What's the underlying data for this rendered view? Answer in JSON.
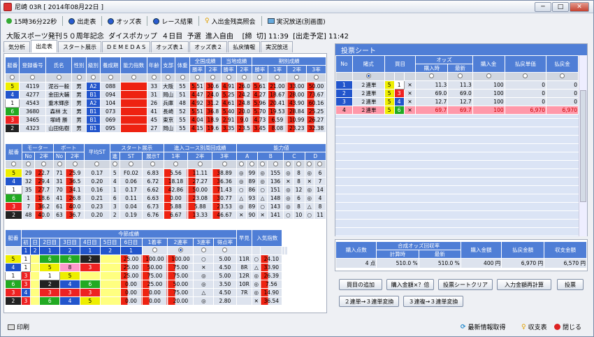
{
  "window": {
    "title": "尼崎 03R [ 2014年08月22日 ]",
    "min": "─",
    "max": "□",
    "close": "✕"
  },
  "toolbar": {
    "time": "15時36分22秒",
    "b1": "出走表",
    "b2": "オッズ表",
    "b3": "レース結果",
    "b4": "入出金残高照会",
    "b5": "実況放送(別画面)"
  },
  "race": "大阪スポーツ発刊５０周年記念  ダイスポカップ  ４日目  予選  進入自由    [締  切] 11:39  [出走予定] 11:42",
  "tabs": [
    "気分析",
    "出走表",
    "スタート展示",
    "D E M E D A S",
    "オッズ表１",
    "オッズ表２",
    "払戻情報",
    "実況放送"
  ],
  "t1": {
    "h": [
      "艇番",
      "登録番号",
      "氏名",
      "性別",
      "級別",
      "養成期",
      "能力指数",
      "年齢",
      "支部",
      "体重",
      "全国成績",
      "当地成績",
      "期別成績"
    ],
    "sub": [
      "勝率",
      "2率",
      "勝率",
      "2率",
      "1率",
      "2率",
      "3率"
    ],
    "rows": [
      [
        "5",
        "4119",
        "泥谷一毅",
        "男",
        "A2",
        "088",
        "",
        "33",
        "大阪",
        "55",
        "5.51",
        "30.6",
        "4.91",
        "26.0",
        "5.61",
        "21.00",
        "33.00",
        "50.00"
      ],
      [
        "4",
        "4277",
        "金田大輔",
        "男",
        "B1",
        "094",
        "",
        "31",
        "岡山",
        "51",
        "4.47",
        "24.0",
        "5.25",
        "24.2",
        "4.27",
        "18.67",
        "28.00",
        "73.67"
      ],
      [
        "1",
        "4543",
        "重木輝彦",
        "男",
        "A2",
        "104",
        "",
        "26",
        "兵庫",
        "48",
        "4.92",
        "31.2",
        "4.61",
        "24.8",
        "5.96",
        "20.41",
        "43.90",
        "60.16"
      ],
      [
        "6",
        "3680",
        "森林  太",
        "男",
        "B1",
        "073",
        "",
        "41",
        "長崎",
        "52",
        "5.51",
        "36.8",
        "5.40",
        "20.0",
        "5.70",
        "19.53",
        "28.84",
        "25.25"
      ],
      [
        "3",
        "3465",
        "塚崎  勝",
        "男",
        "B1",
        "069",
        "",
        "45",
        "東京",
        "55",
        "4.04",
        "18.9",
        "2.91",
        "9.0",
        "4.73",
        "6.59",
        "10.99",
        "26.27"
      ],
      [
        "2",
        "4323",
        "山田佑樹",
        "男",
        "B1",
        "095",
        "",
        "27",
        "岡山",
        "55",
        "4.15",
        "19.6",
        "3.35",
        "23.5",
        "3.45",
        "8.08",
        "23.23",
        "32.38"
      ]
    ]
  },
  "t2": {
    "h": [
      "艇番",
      "モーター",
      "ボート",
      "平均ST",
      "スタート展示",
      "進入コース別周回成績",
      "能力値"
    ],
    "sub": [
      "No",
      "2率",
      "No",
      "2率",
      "進",
      "ST",
      "展示T",
      "1率",
      "2率",
      "3率",
      "A",
      "B",
      "C",
      "D"
    ],
    "rows": [
      [
        "5",
        "29",
        "22.7",
        "71",
        "25.9",
        "0.17",
        "5",
        "F0.02",
        "6.83",
        "5.56",
        "11.11",
        "38.89",
        "◎",
        "99",
        "◎",
        "155",
        "◎",
        "8",
        "◎",
        "6"
      ],
      [
        "4",
        "32",
        "29.4",
        "31",
        "36.5",
        "0.20",
        "4",
        "0.06",
        "6.72",
        "18.18",
        "27.27",
        "36.36",
        "◎",
        "89",
        "◎",
        "136",
        "✕",
        "8",
        "✕",
        "7"
      ],
      [
        "1",
        "35",
        "27.7",
        "70",
        "34.1",
        "0.16",
        "1",
        "0.17",
        "6.62",
        "42.86",
        "50.00",
        "71.43",
        "○",
        "86",
        "○",
        "151",
        "◎",
        "12",
        "◎",
        "14"
      ],
      [
        "6",
        "1",
        "18.6",
        "41",
        "26.8",
        "0.21",
        "6",
        "0.11",
        "6.63",
        "0.00",
        "23.08",
        "30.77",
        "△",
        "93",
        "△",
        "148",
        "◎",
        "6",
        "◎",
        "4"
      ],
      [
        "3",
        "7",
        "36.2",
        "61",
        "40.0",
        "0.23",
        "3",
        "0.04",
        "6.73",
        "5.88",
        "5.88",
        "23.53",
        "◎",
        "89",
        "○",
        "143",
        "◎",
        "8",
        "△",
        "8"
      ],
      [
        "2",
        "48",
        "40.0",
        "63",
        "36.7",
        "0.20",
        "2",
        "0.19",
        "6.76",
        "6.67",
        "13.33",
        "46.67",
        "✕",
        "90",
        "✕",
        "141",
        "○",
        "10",
        "○",
        "11"
      ]
    ]
  },
  "t3": {
    "h": [
      "艇番",
      "今節成績",
      "早見",
      "入気指数"
    ],
    "sub": [
      "初",
      "日",
      "2日目",
      "3日目",
      "4日目",
      "5日目",
      "6日目",
      "1着率",
      "2連率",
      "3連率",
      "得点率"
    ],
    "rows": [
      [
        "5",
        "1",
        "",
        "6",
        "6",
        "2",
        "",
        "25.00",
        "100.00",
        "100.00",
        "○",
        "5.00",
        "11R",
        "○",
        "24.10"
      ],
      [
        "4",
        "1",
        "",
        "5",
        "8",
        "3",
        "",
        "25.00",
        "50.00",
        "75.00",
        "✕",
        "4.50",
        "8R",
        "△",
        "33.90"
      ],
      [
        "1",
        "3",
        "",
        "1",
        "5",
        "",
        "",
        "25.00",
        "75.00",
        "75.00",
        "◎",
        "5.00",
        "12R",
        "◎",
        "26.39"
      ],
      [
        "6",
        "3",
        "",
        "2",
        "4",
        "6",
        "",
        "0.00",
        "25.00",
        "50.00",
        "◎",
        "3.50",
        "10R",
        "◎",
        "7.56"
      ],
      [
        "3",
        "4",
        "",
        "3",
        "3",
        "3",
        "",
        "0.00",
        "0.00",
        "75.00",
        "△",
        "4.50",
        "7R",
        "◎",
        "14.90"
      ],
      [
        "2",
        "3",
        "",
        "6",
        "4",
        "5",
        "",
        "0.00",
        "0.00",
        "20.00",
        "◎",
        "2.80",
        "",
        "✕",
        "36.54"
      ]
    ]
  },
  "sheet": {
    "title": "投票シート",
    "h": [
      "No",
      "賭式",
      "買目",
      "オッズ",
      "購入金",
      "払戻単価",
      "払戻金"
    ],
    "oddsub": [
      "購入時",
      "最新"
    ],
    "rows": [
      [
        "1",
        "２連単",
        "5",
        "1",
        "11.3",
        "11.3",
        "100",
        "0",
        "0"
      ],
      [
        "2",
        "２連単",
        "5",
        "3",
        "69.0",
        "69.0",
        "100",
        "0",
        "0"
      ],
      [
        "3",
        "２連単",
        "5",
        "4",
        "12.7",
        "12.7",
        "100",
        "0",
        "0"
      ],
      [
        "4",
        "２連単",
        "5",
        "6",
        "69.7",
        "69.7",
        "100",
        "6,970",
        "6,970"
      ]
    ]
  },
  "summary": {
    "h": [
      "購入点数",
      "合成オッズ回収率",
      "購入金額",
      "払戻金額",
      "収支金額"
    ],
    "sub": [
      "計算時",
      "最新"
    ],
    "vals": [
      "4 点",
      "510.0 %",
      "510.0 %",
      "400 円",
      "6,970 円",
      "6,570 円"
    ]
  },
  "buttons": {
    "b1": "買目の追加",
    "b2": "購入金額×？倍",
    "b3": "投票シートクリア",
    "b4": "入力金額再計算",
    "b5": "投票",
    "b6": "２連単→３連単変換",
    "b7": "３連複→３連単変換"
  },
  "footer": {
    "print": "印刷",
    "refresh": "最新情報取得",
    "balance": "収支表",
    "close": "閉じる"
  }
}
